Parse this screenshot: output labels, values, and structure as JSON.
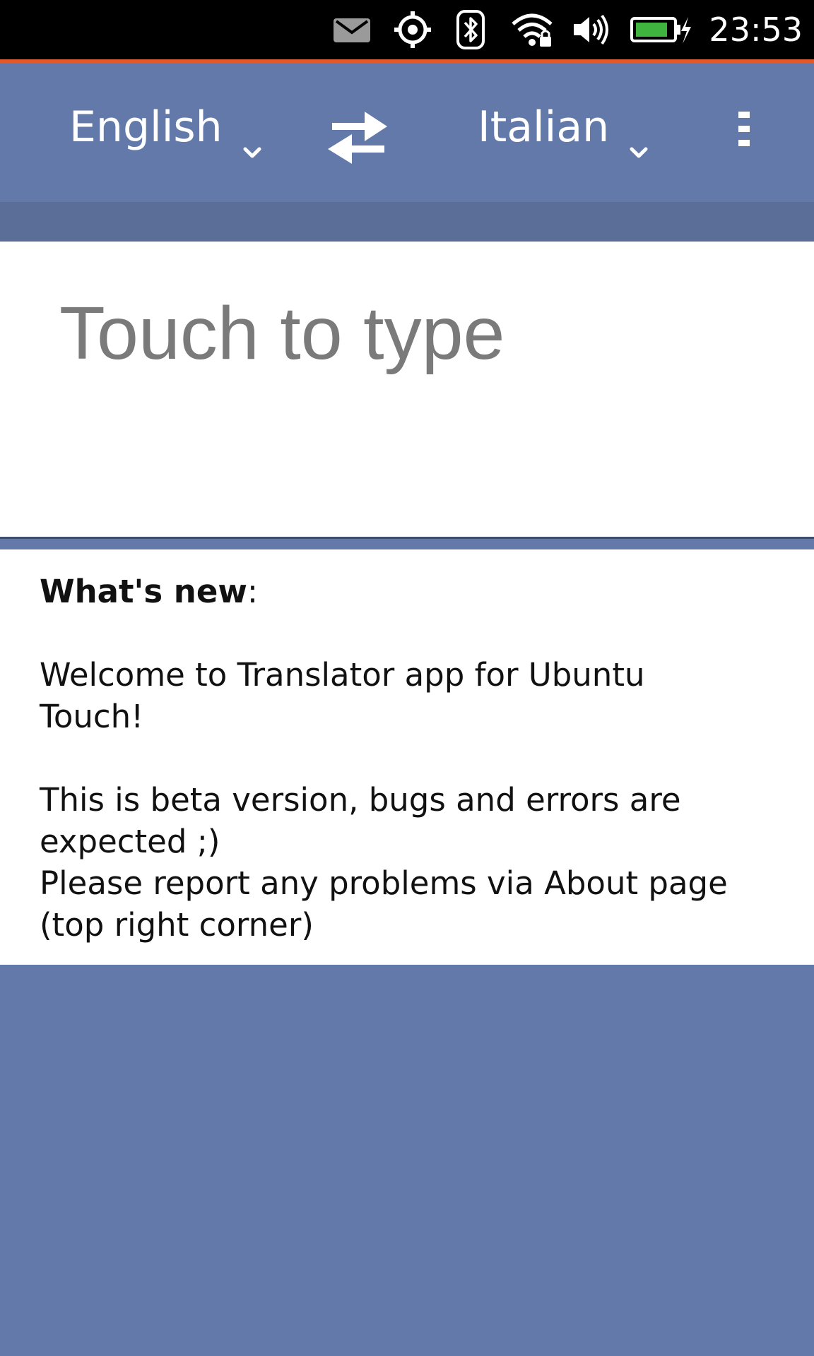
{
  "status_bar": {
    "time": "23:53",
    "icons": [
      "mail-icon",
      "location-icon",
      "bluetooth-icon",
      "wifi-icon",
      "volume-icon",
      "battery-charging-icon"
    ],
    "battery_color": "#3fb43f",
    "accent_color": "#e35a2a"
  },
  "header": {
    "source_language": "English",
    "target_language": "Italian",
    "swap_icon": "swap-arrows-icon",
    "menu_icon": "overflow-menu-icon",
    "background_color": "#6379aa"
  },
  "input": {
    "placeholder": "Touch to type"
  },
  "whats_new": {
    "heading": "What's new",
    "heading_suffix": ":",
    "welcome": "Welcome to Translator app for Ubuntu Touch!",
    "beta_note": "This is beta version, bugs and errors are expected ;)",
    "report_note": "Please report any problems via About page (top right corner)"
  }
}
